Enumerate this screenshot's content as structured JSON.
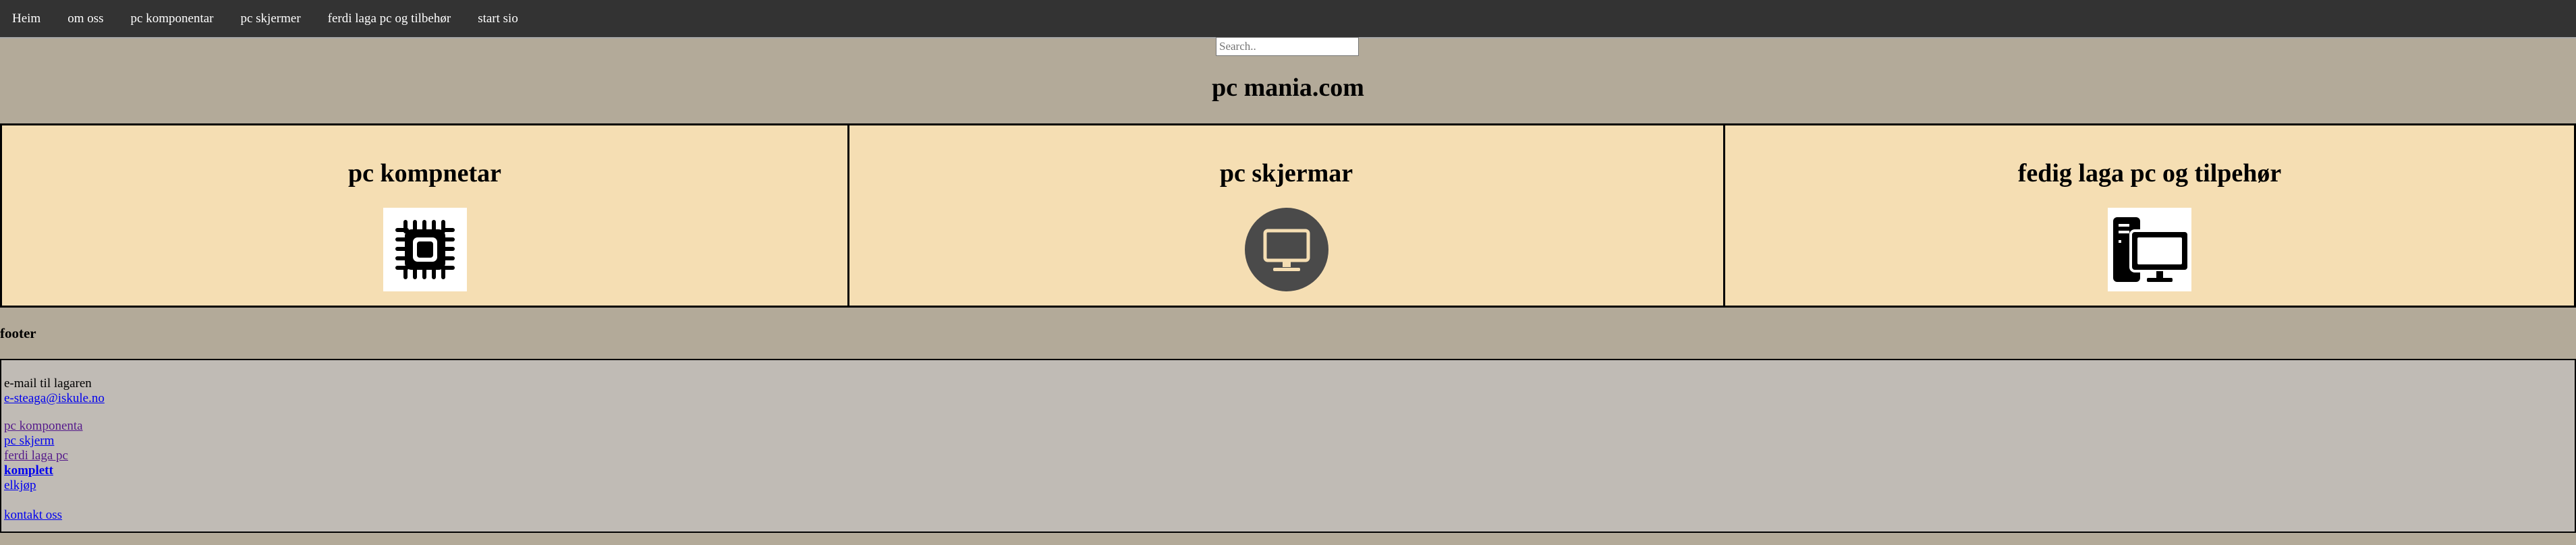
{
  "nav": {
    "items": [
      {
        "label": "Heim"
      },
      {
        "label": "om oss"
      },
      {
        "label": "pc komponentar"
      },
      {
        "label": "pc skjermer"
      },
      {
        "label": "ferdi laga pc og tilbehør"
      },
      {
        "label": "start sio"
      }
    ]
  },
  "search": {
    "placeholder": "Search.."
  },
  "header": {
    "title": "pc mania.com"
  },
  "cards": [
    {
      "title": "pc kompnetar",
      "icon": "cpu-chip-icon"
    },
    {
      "title": "pc skjermar",
      "icon": "monitor-icon"
    },
    {
      "title": "fedig laga pc og tilpehør",
      "icon": "desktop-pc-icon"
    }
  ],
  "footer": {
    "heading": "footer",
    "email_label": "e-mail til lagaren",
    "email": "e-steaga@iskule.no",
    "links": [
      {
        "label": "pc komponenta"
      },
      {
        "label": "pc skjerm"
      },
      {
        "label": "ferdi laga pc"
      },
      {
        "label": "komplett"
      },
      {
        "label": "elkjøp"
      }
    ],
    "contact": "kontakt oss"
  },
  "colors": {
    "nav_bg": "#333333",
    "page_bg": "#b3aa99",
    "card_bg": "#f5deb3",
    "footer_bg": "#c0bbb5",
    "link": "#0000ee",
    "visited_link": "#551a8b"
  }
}
